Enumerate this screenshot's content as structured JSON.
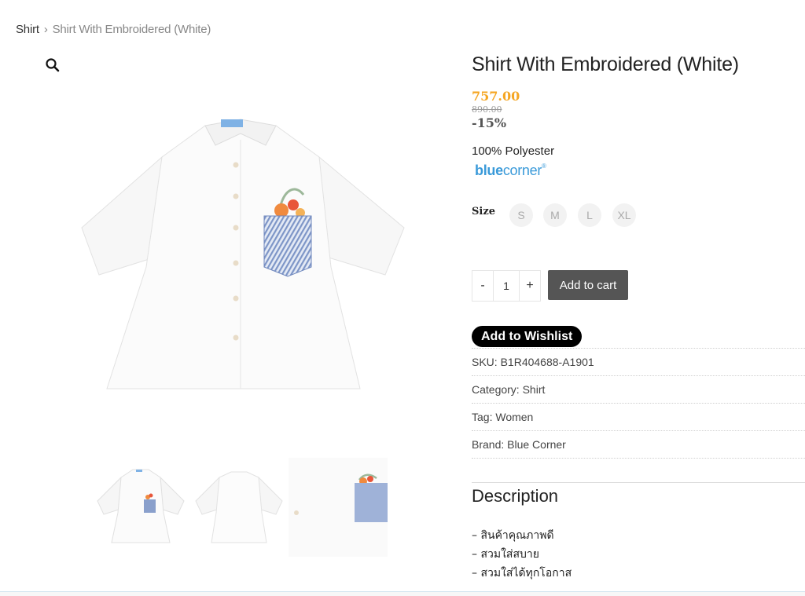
{
  "breadcrumb": {
    "parent": "Shirt",
    "separator": "›",
    "current": "Shirt With Embroidered (White)"
  },
  "product": {
    "title": "Shirt With Embroidered (White)",
    "price_sale": "757.00",
    "price_regular": "890.00",
    "discount": "-15%",
    "material": "100% Polyester",
    "brand_logo": {
      "part1": "blue",
      "part2": "corner",
      "mark": "®"
    }
  },
  "size": {
    "label": "Size",
    "options": [
      "S",
      "M",
      "L",
      "XL"
    ]
  },
  "cart": {
    "minus": "-",
    "quantity": "1",
    "plus": "+",
    "add_label": "Add to cart"
  },
  "wishlist_label": "Add to Wishlist",
  "meta": {
    "sku_label": "SKU:",
    "sku": "B1R404688-A1901",
    "category_label": "Category:",
    "category": "Shirt",
    "tag_label": "Tag:",
    "tag": "Women",
    "brand_label": "Brand:",
    "brand": "Blue Corner"
  },
  "description": {
    "heading": "Description",
    "items": [
      "– สินค้าคุณภาพดี",
      "– สวมใส่สบาย",
      "– สวมใส่ได้ทุกโอกาส"
    ]
  },
  "icons": {
    "zoom": "magnifier-icon"
  },
  "colors": {
    "sale_price": "#f5a623",
    "brand_blue": "#3a9ad9",
    "cart_button": "#555555",
    "wishlist_button": "#000000",
    "pocket_stripe": "#7d95c7"
  }
}
